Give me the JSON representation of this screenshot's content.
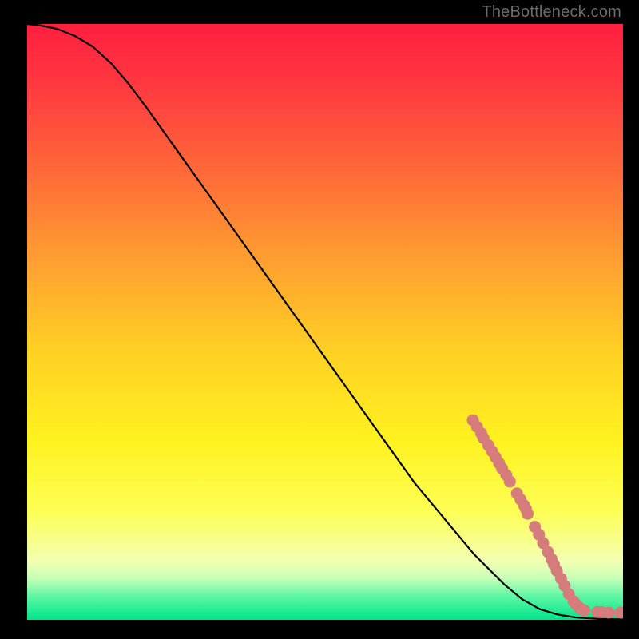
{
  "attribution": "TheBottleneck.com",
  "colors": {
    "frame": "#000000",
    "attribution_text": "#6a6a6a",
    "curve": "#000000",
    "dot": "#d77c7c",
    "gradient": [
      {
        "offset": "0%",
        "color": "#ff1f40"
      },
      {
        "offset": "10%",
        "color": "#ff3840"
      },
      {
        "offset": "25%",
        "color": "#ff6a38"
      },
      {
        "offset": "40%",
        "color": "#ffa030"
      },
      {
        "offset": "55%",
        "color": "#ffd024"
      },
      {
        "offset": "70%",
        "color": "#fff220"
      },
      {
        "offset": "82%",
        "color": "#fdff55"
      },
      {
        "offset": "90%",
        "color": "#f3ffb0"
      },
      {
        "offset": "93%",
        "color": "#c8ffb8"
      },
      {
        "offset": "96%",
        "color": "#5ff7a4"
      },
      {
        "offset": "100%",
        "color": "#00e48a"
      }
    ]
  },
  "chart_data": {
    "type": "line",
    "title": "",
    "xlabel": "",
    "ylabel": "",
    "xlim": [
      0,
      100
    ],
    "ylim": [
      0,
      100
    ],
    "curve": [
      {
        "x": 0,
        "y": 100
      },
      {
        "x": 2,
        "y": 99.8
      },
      {
        "x": 5,
        "y": 99.2
      },
      {
        "x": 8,
        "y": 98.0
      },
      {
        "x": 11,
        "y": 96.2
      },
      {
        "x": 14,
        "y": 93.5
      },
      {
        "x": 17,
        "y": 90.0
      },
      {
        "x": 20,
        "y": 86.0
      },
      {
        "x": 25,
        "y": 79.0
      },
      {
        "x": 30,
        "y": 72.0
      },
      {
        "x": 35,
        "y": 65.0
      },
      {
        "x": 40,
        "y": 58.0
      },
      {
        "x": 45,
        "y": 51.0
      },
      {
        "x": 50,
        "y": 44.0
      },
      {
        "x": 55,
        "y": 37.0
      },
      {
        "x": 60,
        "y": 30.0
      },
      {
        "x": 65,
        "y": 23.0
      },
      {
        "x": 70,
        "y": 17.0
      },
      {
        "x": 75,
        "y": 11.0
      },
      {
        "x": 80,
        "y": 6.0
      },
      {
        "x": 83,
        "y": 3.5
      },
      {
        "x": 86,
        "y": 1.8
      },
      {
        "x": 89,
        "y": 0.9
      },
      {
        "x": 92,
        "y": 0.4
      },
      {
        "x": 96,
        "y": 0.15
      },
      {
        "x": 100,
        "y": 0.1
      }
    ],
    "points": [
      {
        "x": 74.8,
        "y": 33.5
      },
      {
        "x": 75.5,
        "y": 32.4
      },
      {
        "x": 76.2,
        "y": 31.3
      },
      {
        "x": 76.6,
        "y": 30.5
      },
      {
        "x": 77.4,
        "y": 29.3
      },
      {
        "x": 78.0,
        "y": 28.3
      },
      {
        "x": 78.6,
        "y": 27.3
      },
      {
        "x": 79.2,
        "y": 26.3
      },
      {
        "x": 79.7,
        "y": 25.4
      },
      {
        "x": 80.4,
        "y": 24.3
      },
      {
        "x": 81.0,
        "y": 23.2
      },
      {
        "x": 82.2,
        "y": 21.2
      },
      {
        "x": 82.8,
        "y": 20.2
      },
      {
        "x": 83.4,
        "y": 19.2
      },
      {
        "x": 83.7,
        "y": 18.6
      },
      {
        "x": 84.0,
        "y": 17.8
      },
      {
        "x": 85.2,
        "y": 15.6
      },
      {
        "x": 85.9,
        "y": 14.3
      },
      {
        "x": 86.6,
        "y": 12.9
      },
      {
        "x": 87.4,
        "y": 11.4
      },
      {
        "x": 88.0,
        "y": 10.2
      },
      {
        "x": 88.4,
        "y": 9.3
      },
      {
        "x": 88.9,
        "y": 8.2
      },
      {
        "x": 89.6,
        "y": 6.9
      },
      {
        "x": 90.2,
        "y": 5.7
      },
      {
        "x": 90.9,
        "y": 4.3
      },
      {
        "x": 91.7,
        "y": 3.1
      },
      {
        "x": 92.1,
        "y": 2.6
      },
      {
        "x": 92.6,
        "y": 2.1
      },
      {
        "x": 93.0,
        "y": 1.8
      },
      {
        "x": 93.5,
        "y": 1.6
      },
      {
        "x": 95.7,
        "y": 1.3
      },
      {
        "x": 96.3,
        "y": 1.3
      },
      {
        "x": 97.6,
        "y": 1.2
      },
      {
        "x": 99.6,
        "y": 1.2
      },
      {
        "x": 100.2,
        "y": 1.2
      }
    ]
  }
}
